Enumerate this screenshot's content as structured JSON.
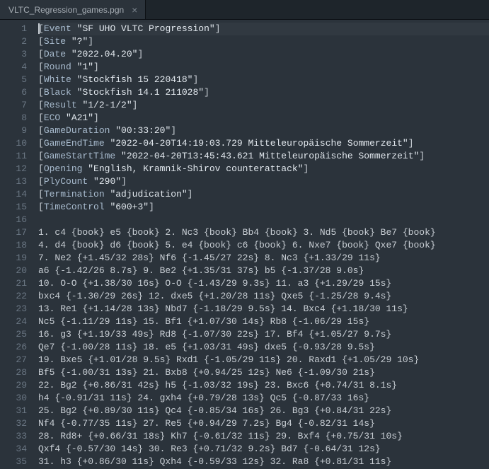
{
  "tab": {
    "filename": "VLTC_Regression_games.pgn",
    "close_glyph": "×"
  },
  "lines": [
    {
      "n": 1,
      "type": "header",
      "key": "Event",
      "val": "\"SF UHO VLTC Progression\"",
      "current": true
    },
    {
      "n": 2,
      "type": "header",
      "key": "Site",
      "val": "\"?\""
    },
    {
      "n": 3,
      "type": "header",
      "key": "Date",
      "val": "\"2022.04.20\""
    },
    {
      "n": 4,
      "type": "header",
      "key": "Round",
      "val": "\"1\""
    },
    {
      "n": 5,
      "type": "header",
      "key": "White",
      "val": "\"Stockfish 15 220418\""
    },
    {
      "n": 6,
      "type": "header",
      "key": "Black",
      "val": "\"Stockfish 14.1 211028\""
    },
    {
      "n": 7,
      "type": "header",
      "key": "Result",
      "val": "\"1/2-1/2\""
    },
    {
      "n": 8,
      "type": "header",
      "key": "ECO",
      "val": "\"A21\""
    },
    {
      "n": 9,
      "type": "header",
      "key": "GameDuration",
      "val": "\"00:33:20\""
    },
    {
      "n": 10,
      "type": "header",
      "key": "GameEndTime",
      "val": "\"2022-04-20T14:19:03.729 Mitteleuropäische Sommerzeit\""
    },
    {
      "n": 11,
      "type": "header",
      "key": "GameStartTime",
      "val": "\"2022-04-20T13:45:43.621 Mitteleuropäische Sommerzeit\""
    },
    {
      "n": 12,
      "type": "header",
      "key": "Opening",
      "val": "\"English, Kramnik-Shirov counterattack\""
    },
    {
      "n": 13,
      "type": "header",
      "key": "PlyCount",
      "val": "\"290\""
    },
    {
      "n": 14,
      "type": "header",
      "key": "Termination",
      "val": "\"adjudication\""
    },
    {
      "n": 15,
      "type": "header",
      "key": "TimeControl",
      "val": "\"600+3\""
    },
    {
      "n": 16,
      "type": "blank",
      "text": ""
    },
    {
      "n": 17,
      "type": "move",
      "text": "1. c4 {book} e5 {book} 2. Nc3 {book} Bb4 {book} 3. Nd5 {book} Be7 {book}"
    },
    {
      "n": 18,
      "type": "move",
      "text": "4. d4 {book} d6 {book} 5. e4 {book} c6 {book} 6. Nxe7 {book} Qxe7 {book}"
    },
    {
      "n": 19,
      "type": "move",
      "text": "7. Ne2 {+1.45/32 28s} Nf6 {-1.45/27 22s} 8. Nc3 {+1.33/29 11s}"
    },
    {
      "n": 20,
      "type": "move",
      "text": "a6 {-1.42/26 8.7s} 9. Be2 {+1.35/31 37s} b5 {-1.37/28 9.0s}"
    },
    {
      "n": 21,
      "type": "move",
      "text": "10. O-O {+1.38/30 16s} O-O {-1.43/29 9.3s} 11. a3 {+1.29/29 15s}"
    },
    {
      "n": 22,
      "type": "move",
      "text": "bxc4 {-1.30/29 26s} 12. dxe5 {+1.20/28 11s} Qxe5 {-1.25/28 9.4s}"
    },
    {
      "n": 23,
      "type": "move",
      "text": "13. Re1 {+1.14/28 13s} Nbd7 {-1.18/29 9.5s} 14. Bxc4 {+1.18/30 11s}"
    },
    {
      "n": 24,
      "type": "move",
      "text": "Nc5 {-1.11/29 11s} 15. Bf1 {+1.07/30 14s} Rb8 {-1.06/29 15s}"
    },
    {
      "n": 25,
      "type": "move",
      "text": "16. g3 {+1.19/33 49s} Rd8 {-1.07/30 22s} 17. Bf4 {+1.05/27 9.7s}"
    },
    {
      "n": 26,
      "type": "move",
      "text": "Qe7 {-1.00/28 11s} 18. e5 {+1.03/31 49s} dxe5 {-0.93/28 9.5s}"
    },
    {
      "n": 27,
      "type": "move",
      "text": "19. Bxe5 {+1.01/28 9.5s} Rxd1 {-1.05/29 11s} 20. Raxd1 {+1.05/29 10s}"
    },
    {
      "n": 28,
      "type": "move",
      "text": "Bf5 {-1.00/31 13s} 21. Bxb8 {+0.94/25 12s} Ne6 {-1.09/30 21s}"
    },
    {
      "n": 29,
      "type": "move",
      "text": "22. Bg2 {+0.86/31 42s} h5 {-1.03/32 19s} 23. Bxc6 {+0.74/31 8.1s}"
    },
    {
      "n": 30,
      "type": "move",
      "text": "h4 {-0.91/31 11s} 24. gxh4 {+0.79/28 13s} Qc5 {-0.87/33 16s}"
    },
    {
      "n": 31,
      "type": "move",
      "text": "25. Bg2 {+0.89/30 11s} Qc4 {-0.85/34 16s} 26. Bg3 {+0.84/31 22s}"
    },
    {
      "n": 32,
      "type": "move",
      "text": "Nf4 {-0.77/35 11s} 27. Re5 {+0.94/29 7.2s} Bg4 {-0.82/31 14s}"
    },
    {
      "n": 33,
      "type": "move",
      "text": "28. Rd8+ {+0.66/31 18s} Kh7 {-0.61/32 11s} 29. Bxf4 {+0.75/31 10s}"
    },
    {
      "n": 34,
      "type": "move",
      "text": "Qxf4 {-0.57/30 14s} 30. Re3 {+0.71/32 9.2s} Bd7 {-0.64/31 12s}"
    },
    {
      "n": 35,
      "type": "move",
      "text": "31. h3 {+0.86/30 11s} Qxh4 {-0.59/33 12s} 32. Ra8 {+0.81/31 11s}"
    }
  ]
}
